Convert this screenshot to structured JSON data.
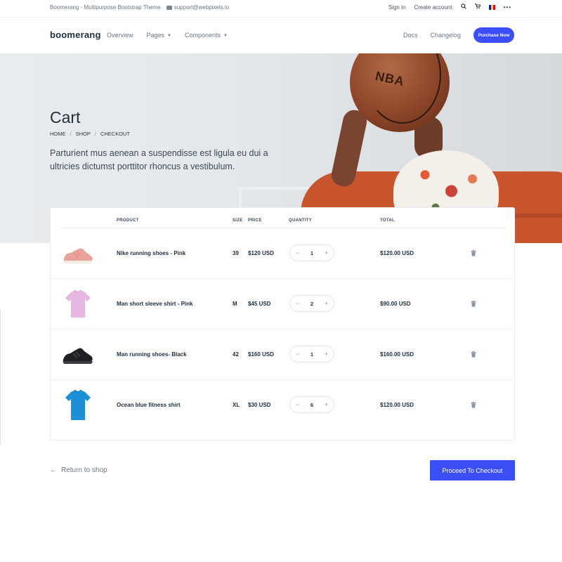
{
  "topbar": {
    "site_title": "Boomerang - Multipurpose Bootstrap Theme",
    "email": "support@webpixels.io",
    "sign_in": "Sign in",
    "create_account": "Create account",
    "more": "•••",
    "flag_colors": [
      "#002b7f",
      "#fcd116",
      "#ce1126"
    ]
  },
  "nav": {
    "brand": "boomerang",
    "overview": "Overview",
    "pages": "Pages",
    "components": "Components",
    "docs": "Docs",
    "changelog": "Changelog",
    "purchase": "Purchase Now",
    "caret": "▼"
  },
  "hero": {
    "title": "Cart",
    "breadcrumb": [
      "HOME",
      "SHOP",
      "CHECKOUT"
    ],
    "separator": "/",
    "lead": "Parturient mus aenean a suspendisse est ligula eu dui a ultricies dictumst porttitor rhoncus a vestibulum.",
    "ball_text": "NBA"
  },
  "cart": {
    "headers": {
      "product": "PRODUCT",
      "size": "SIZE",
      "price": "PRICE",
      "quantity": "QUANTITY",
      "total": "TOTAL"
    },
    "items": [
      {
        "name": "Nike running shoes - Pink",
        "size": "39",
        "price": "$120 USD",
        "quantity": "1",
        "total": "$120.00 USD",
        "image": "pink-sneaker"
      },
      {
        "name": "Man short sleeve shirt - Pink",
        "size": "M",
        "price": "$45 USD",
        "quantity": "2",
        "total": "$90.00 USD",
        "image": "pink-tshirt"
      },
      {
        "name": "Man running shoes- Black",
        "size": "42",
        "price": "$160 USD",
        "quantity": "1",
        "total": "$160.00 USD",
        "image": "black-sneaker"
      },
      {
        "name": "Ocean blue fitness shirt",
        "size": "XL",
        "price": "$30 USD",
        "quantity": "6",
        "total": "$120.00 USD",
        "image": "blue-tshirt"
      }
    ],
    "minus": "−",
    "plus": "+"
  },
  "actions": {
    "return_arrow": "←",
    "return": "Return to shop",
    "checkout": "Proceed To Checkout"
  },
  "colors": {
    "primary": "#3b4ef8",
    "text": "#1f2d3d",
    "muted": "#6b7684"
  }
}
